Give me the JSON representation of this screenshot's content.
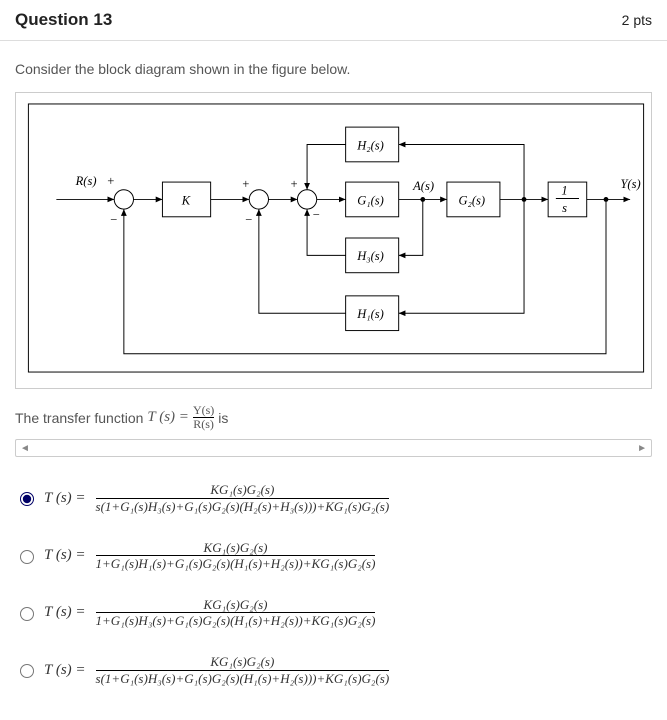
{
  "header": {
    "title": "Question 13",
    "points": "2 pts"
  },
  "prompt": "Consider the block diagram shown in the figure below.",
  "diagram": {
    "R": "R(s)",
    "Y": "Y(s)",
    "K": "K",
    "G1": "G₁(s)",
    "G2": "G₂(s)",
    "H1": "H₁(s)",
    "H2": "H₂(s)",
    "H3": "H₃(s)",
    "A": "A(s)",
    "oneS_num": "1",
    "oneS_den": "s",
    "plus1": "+",
    "minus1": "−",
    "plus2": "+",
    "minus2": "−",
    "plus3": "+",
    "minus3": "−"
  },
  "transfer": {
    "pre": "The transfer function ",
    "T": "T (s) = ",
    "frac_num": "Y(s)",
    "frac_den": "R(s)",
    "post": " is"
  },
  "options": [
    {
      "lhs": "T (s)  =  ",
      "num": "KG₁(s)G₂(s)",
      "den": "s(1+G₁(s)H₃(s)+G₁(s)G₂(s)(H₂(s)+H₃(s)))+KG₁(s)G₂(s)"
    },
    {
      "lhs": "T (s)  =  ",
      "num": "KG₁(s)G₂(s)",
      "den": "1+G₁(s)H₁(s)+G₁(s)G₂(s)(H₁(s)+H₂(s))+KG₁(s)G₂(s)"
    },
    {
      "lhs": "T (s)  =  ",
      "num": "KG₁(s)G₂(s)",
      "den": "1+G₁(s)H₃(s)+G₁(s)G₂(s)(H₁(s)+H₂(s))+KG₁(s)G₂(s)"
    },
    {
      "lhs": "T (s)  =  ",
      "num": "KG₁(s)G₂(s)",
      "den": "s(1+G₁(s)H₃(s)+G₁(s)G₂(s)(H₁(s)+H₂(s)))+KG₁(s)G₂(s)"
    }
  ],
  "selected": 0,
  "scroller": {
    "left": "◄",
    "right": "►"
  }
}
